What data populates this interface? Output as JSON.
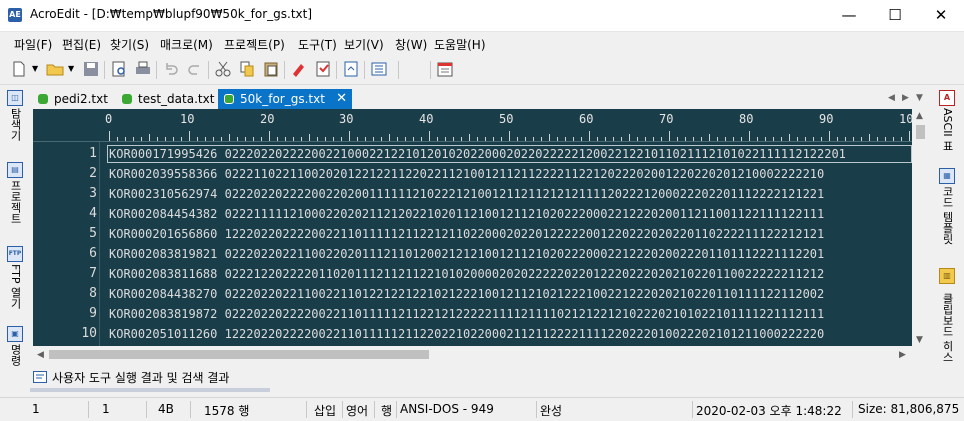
{
  "window": {
    "title": "AcroEdit - [D:₩temp₩blupf90₩50k_for_gs.txt]",
    "app_icon": "AE"
  },
  "menu": [
    "파일(F)",
    "편집(E)",
    "찾기(S)",
    "매크로(M)",
    "프로젝트(P)",
    "도구(T)",
    "보기(V)",
    "창(W)",
    "도움말(H)"
  ],
  "left_panel": {
    "explorer": "탐색기",
    "project": "프로젝트",
    "ftp": "FTP 열기",
    "more": "명령"
  },
  "right_panel": {
    "ascii": "ASCII 표",
    "code_template": "코드 템플릿",
    "clipboard": "클립보드 히스"
  },
  "tabs": [
    {
      "label": "pedi2.txt"
    },
    {
      "label": "test_data.txt"
    },
    {
      "label": "50k_for_gs.txt",
      "active": true
    }
  ],
  "ruler": [
    "0",
    "10",
    "20",
    "30",
    "40",
    "50",
    "60",
    "70",
    "80",
    "90",
    "10"
  ],
  "lines": [
    {
      "num": "1",
      "text": "KOR000171995426 02220220222200221000221221012010202200020220222221200221221011021112101022111112122201"
    },
    {
      "num": "2",
      "text": "KOR002039558366 02221102211002020122122112202211210012112112222112212022202001220220201210002222210"
    },
    {
      "num": "3",
      "text": "KOR002310562974 02220220222200220200111111210222121001211211212121111202221200022202201112222121221"
    },
    {
      "num": "4",
      "text": "KOR002084454382 02221111121000220202112120221020112100121121020222000221222020011211001122111122111"
    },
    {
      "num": "5",
      "text": "KOR000201656860 12220220222200221101111121122121102200020220122222001220222020220110222211122212121"
    },
    {
      "num": "6",
      "text": "KOR002083819821 02220220221100220201112110120021212100121121020222000221222020022201101112221112201"
    },
    {
      "num": "7",
      "text": "KOR002083811688 02221220222201102011121121122101020000202022222022012220222020210220110022222211212"
    },
    {
      "num": "8",
      "text": "KOR002084438270 02220220221100221101221221221021222100121121021222100221222020210220110111122112002"
    },
    {
      "num": "9",
      "text": "KOR002083819872 02220220222200221101111121122121222221111211110212122121022202101022101111221112111"
    },
    {
      "num": "10",
      "text": "KOR002051011260 12220220222200221101111121122022102200021121122221111220222010022202101211000222220"
    }
  ],
  "output_panel": {
    "title": "사용자 도구 실행 결과 및 검색 결과"
  },
  "status": {
    "line": "1",
    "col": "1",
    "size_short": "4B",
    "line_count": "1578 행",
    "insert": "삽입",
    "lang": "영어",
    "row_mode": "행",
    "encoding": "ANSI-DOS - 949",
    "complete": "완성",
    "datetime": "2020-02-03 오후 1:48:22",
    "size": "Size: 81,806,875"
  }
}
